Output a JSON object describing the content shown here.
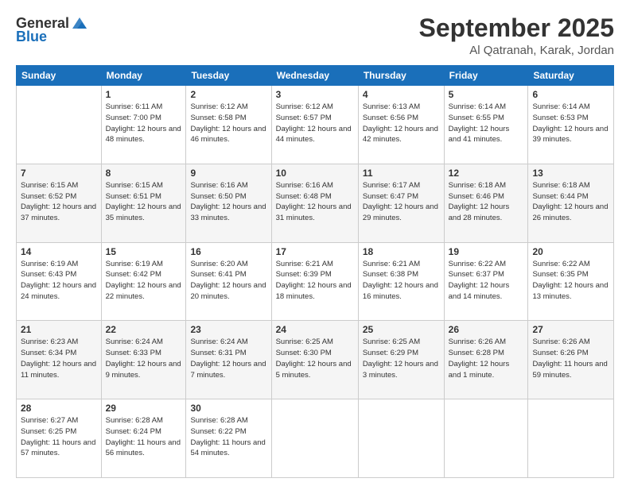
{
  "header": {
    "logo_general": "General",
    "logo_blue": "Blue",
    "month": "September 2025",
    "location": "Al Qatranah, Karak, Jordan"
  },
  "weekdays": [
    "Sunday",
    "Monday",
    "Tuesday",
    "Wednesday",
    "Thursday",
    "Friday",
    "Saturday"
  ],
  "weeks": [
    [
      {
        "day": "",
        "sunrise": "",
        "sunset": "",
        "daylight": ""
      },
      {
        "day": "1",
        "sunrise": "Sunrise: 6:11 AM",
        "sunset": "Sunset: 7:00 PM",
        "daylight": "Daylight: 12 hours and 48 minutes."
      },
      {
        "day": "2",
        "sunrise": "Sunrise: 6:12 AM",
        "sunset": "Sunset: 6:58 PM",
        "daylight": "Daylight: 12 hours and 46 minutes."
      },
      {
        "day": "3",
        "sunrise": "Sunrise: 6:12 AM",
        "sunset": "Sunset: 6:57 PM",
        "daylight": "Daylight: 12 hours and 44 minutes."
      },
      {
        "day": "4",
        "sunrise": "Sunrise: 6:13 AM",
        "sunset": "Sunset: 6:56 PM",
        "daylight": "Daylight: 12 hours and 42 minutes."
      },
      {
        "day": "5",
        "sunrise": "Sunrise: 6:14 AM",
        "sunset": "Sunset: 6:55 PM",
        "daylight": "Daylight: 12 hours and 41 minutes."
      },
      {
        "day": "6",
        "sunrise": "Sunrise: 6:14 AM",
        "sunset": "Sunset: 6:53 PM",
        "daylight": "Daylight: 12 hours and 39 minutes."
      }
    ],
    [
      {
        "day": "7",
        "sunrise": "Sunrise: 6:15 AM",
        "sunset": "Sunset: 6:52 PM",
        "daylight": "Daylight: 12 hours and 37 minutes."
      },
      {
        "day": "8",
        "sunrise": "Sunrise: 6:15 AM",
        "sunset": "Sunset: 6:51 PM",
        "daylight": "Daylight: 12 hours and 35 minutes."
      },
      {
        "day": "9",
        "sunrise": "Sunrise: 6:16 AM",
        "sunset": "Sunset: 6:50 PM",
        "daylight": "Daylight: 12 hours and 33 minutes."
      },
      {
        "day": "10",
        "sunrise": "Sunrise: 6:16 AM",
        "sunset": "Sunset: 6:48 PM",
        "daylight": "Daylight: 12 hours and 31 minutes."
      },
      {
        "day": "11",
        "sunrise": "Sunrise: 6:17 AM",
        "sunset": "Sunset: 6:47 PM",
        "daylight": "Daylight: 12 hours and 29 minutes."
      },
      {
        "day": "12",
        "sunrise": "Sunrise: 6:18 AM",
        "sunset": "Sunset: 6:46 PM",
        "daylight": "Daylight: 12 hours and 28 minutes."
      },
      {
        "day": "13",
        "sunrise": "Sunrise: 6:18 AM",
        "sunset": "Sunset: 6:44 PM",
        "daylight": "Daylight: 12 hours and 26 minutes."
      }
    ],
    [
      {
        "day": "14",
        "sunrise": "Sunrise: 6:19 AM",
        "sunset": "Sunset: 6:43 PM",
        "daylight": "Daylight: 12 hours and 24 minutes."
      },
      {
        "day": "15",
        "sunrise": "Sunrise: 6:19 AM",
        "sunset": "Sunset: 6:42 PM",
        "daylight": "Daylight: 12 hours and 22 minutes."
      },
      {
        "day": "16",
        "sunrise": "Sunrise: 6:20 AM",
        "sunset": "Sunset: 6:41 PM",
        "daylight": "Daylight: 12 hours and 20 minutes."
      },
      {
        "day": "17",
        "sunrise": "Sunrise: 6:21 AM",
        "sunset": "Sunset: 6:39 PM",
        "daylight": "Daylight: 12 hours and 18 minutes."
      },
      {
        "day": "18",
        "sunrise": "Sunrise: 6:21 AM",
        "sunset": "Sunset: 6:38 PM",
        "daylight": "Daylight: 12 hours and 16 minutes."
      },
      {
        "day": "19",
        "sunrise": "Sunrise: 6:22 AM",
        "sunset": "Sunset: 6:37 PM",
        "daylight": "Daylight: 12 hours and 14 minutes."
      },
      {
        "day": "20",
        "sunrise": "Sunrise: 6:22 AM",
        "sunset": "Sunset: 6:35 PM",
        "daylight": "Daylight: 12 hours and 13 minutes."
      }
    ],
    [
      {
        "day": "21",
        "sunrise": "Sunrise: 6:23 AM",
        "sunset": "Sunset: 6:34 PM",
        "daylight": "Daylight: 12 hours and 11 minutes."
      },
      {
        "day": "22",
        "sunrise": "Sunrise: 6:24 AM",
        "sunset": "Sunset: 6:33 PM",
        "daylight": "Daylight: 12 hours and 9 minutes."
      },
      {
        "day": "23",
        "sunrise": "Sunrise: 6:24 AM",
        "sunset": "Sunset: 6:31 PM",
        "daylight": "Daylight: 12 hours and 7 minutes."
      },
      {
        "day": "24",
        "sunrise": "Sunrise: 6:25 AM",
        "sunset": "Sunset: 6:30 PM",
        "daylight": "Daylight: 12 hours and 5 minutes."
      },
      {
        "day": "25",
        "sunrise": "Sunrise: 6:25 AM",
        "sunset": "Sunset: 6:29 PM",
        "daylight": "Daylight: 12 hours and 3 minutes."
      },
      {
        "day": "26",
        "sunrise": "Sunrise: 6:26 AM",
        "sunset": "Sunset: 6:28 PM",
        "daylight": "Daylight: 12 hours and 1 minute."
      },
      {
        "day": "27",
        "sunrise": "Sunrise: 6:26 AM",
        "sunset": "Sunset: 6:26 PM",
        "daylight": "Daylight: 11 hours and 59 minutes."
      }
    ],
    [
      {
        "day": "28",
        "sunrise": "Sunrise: 6:27 AM",
        "sunset": "Sunset: 6:25 PM",
        "daylight": "Daylight: 11 hours and 57 minutes."
      },
      {
        "day": "29",
        "sunrise": "Sunrise: 6:28 AM",
        "sunset": "Sunset: 6:24 PM",
        "daylight": "Daylight: 11 hours and 56 minutes."
      },
      {
        "day": "30",
        "sunrise": "Sunrise: 6:28 AM",
        "sunset": "Sunset: 6:22 PM",
        "daylight": "Daylight: 11 hours and 54 minutes."
      },
      {
        "day": "",
        "sunrise": "",
        "sunset": "",
        "daylight": ""
      },
      {
        "day": "",
        "sunrise": "",
        "sunset": "",
        "daylight": ""
      },
      {
        "day": "",
        "sunrise": "",
        "sunset": "",
        "daylight": ""
      },
      {
        "day": "",
        "sunrise": "",
        "sunset": "",
        "daylight": ""
      }
    ]
  ]
}
